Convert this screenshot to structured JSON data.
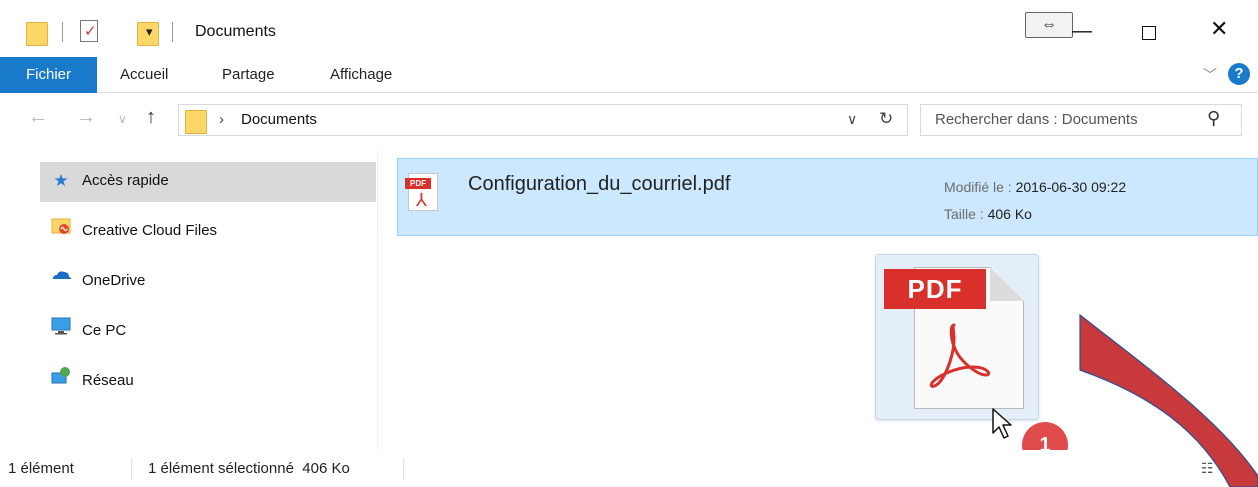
{
  "window": {
    "title": "Documents",
    "controls": {
      "move_icon": "⇔",
      "minimize": "—",
      "close": "✕"
    }
  },
  "ribbon": {
    "tabs": [
      "Fichier",
      "Accueil",
      "Partage",
      "Affichage"
    ],
    "expand_icon": "chevron-down-icon",
    "help_label": "?"
  },
  "address": {
    "crumb_separator": "›",
    "path": "Documents",
    "search_placeholder": "Rechercher dans : Documents"
  },
  "sidebar": {
    "items": [
      {
        "label": "Accès rapide",
        "icon": "star-icon",
        "active": true
      },
      {
        "label": "Creative Cloud Files",
        "icon": "creative-cloud-folder-icon"
      },
      {
        "label": "OneDrive",
        "icon": "onedrive-icon"
      },
      {
        "label": "Ce PC",
        "icon": "computer-icon"
      },
      {
        "label": "Réseau",
        "icon": "network-icon"
      }
    ]
  },
  "files": [
    {
      "name": "Configuration_du_courriel.pdf",
      "icon_badge": "PDF",
      "modified_key": "Modifié le :",
      "modified_value": "2016-06-30 09:22",
      "size_key": "Taille :",
      "size_value": "406 Ko"
    }
  ],
  "drag_preview": {
    "badge": "PDF"
  },
  "step_badge": "1",
  "status": {
    "count": "1 élément",
    "selection": "1 élément sélectionné  406 Ko"
  },
  "colors": {
    "accent": "#1979ca",
    "selection": "#cce8ff",
    "pdf_red": "#d9302c",
    "callout_red": "#c8393b"
  }
}
